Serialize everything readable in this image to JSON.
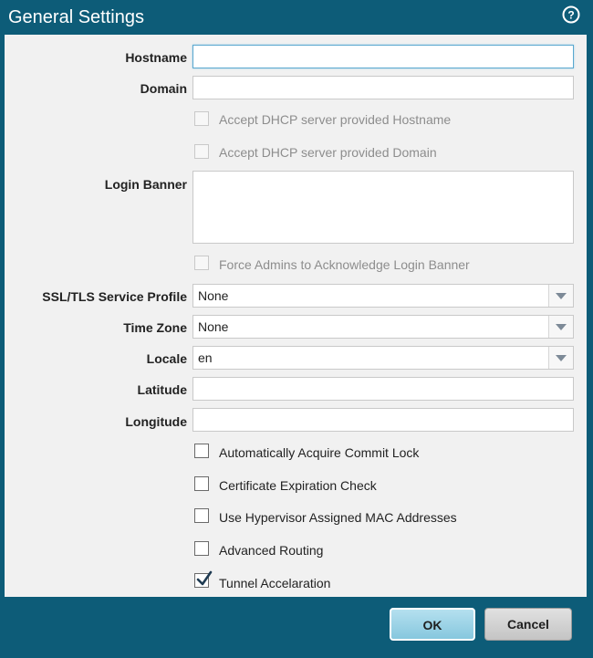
{
  "dialog": {
    "title": "General Settings",
    "help_icon": "question-circle-icon"
  },
  "fields": {
    "hostname": {
      "label": "Hostname",
      "value": ""
    },
    "domain": {
      "label": "Domain",
      "value": ""
    },
    "dhcp_hostname": {
      "label": "Accept DHCP server provided Hostname",
      "checked": false,
      "disabled": true
    },
    "dhcp_domain": {
      "label": "Accept DHCP server provided Domain",
      "checked": false,
      "disabled": true
    },
    "login_banner": {
      "label": "Login Banner",
      "value": ""
    },
    "force_ack": {
      "label": "Force Admins to Acknowledge Login Banner",
      "checked": false,
      "disabled": true
    },
    "ssl_tls_profile": {
      "label": "SSL/TLS Service Profile",
      "value": "None"
    },
    "time_zone": {
      "label": "Time Zone",
      "value": "None"
    },
    "locale": {
      "label": "Locale",
      "value": "en"
    },
    "latitude": {
      "label": "Latitude",
      "value": ""
    },
    "longitude": {
      "label": "Longitude",
      "value": ""
    }
  },
  "options": [
    {
      "label": "Automatically Acquire Commit Lock",
      "checked": false
    },
    {
      "label": "Certificate Expiration Check",
      "checked": false
    },
    {
      "label": "Use Hypervisor Assigned  MAC Addresses",
      "checked": false
    },
    {
      "label": "Advanced Routing",
      "checked": false
    },
    {
      "label": "Tunnel Accelaration",
      "checked": true
    }
  ],
  "buttons": {
    "ok": "OK",
    "cancel": "Cancel"
  },
  "colors": {
    "frame": "#0d5c78",
    "body": "#f1f1f1",
    "ok_button": "#9fd4e6"
  }
}
